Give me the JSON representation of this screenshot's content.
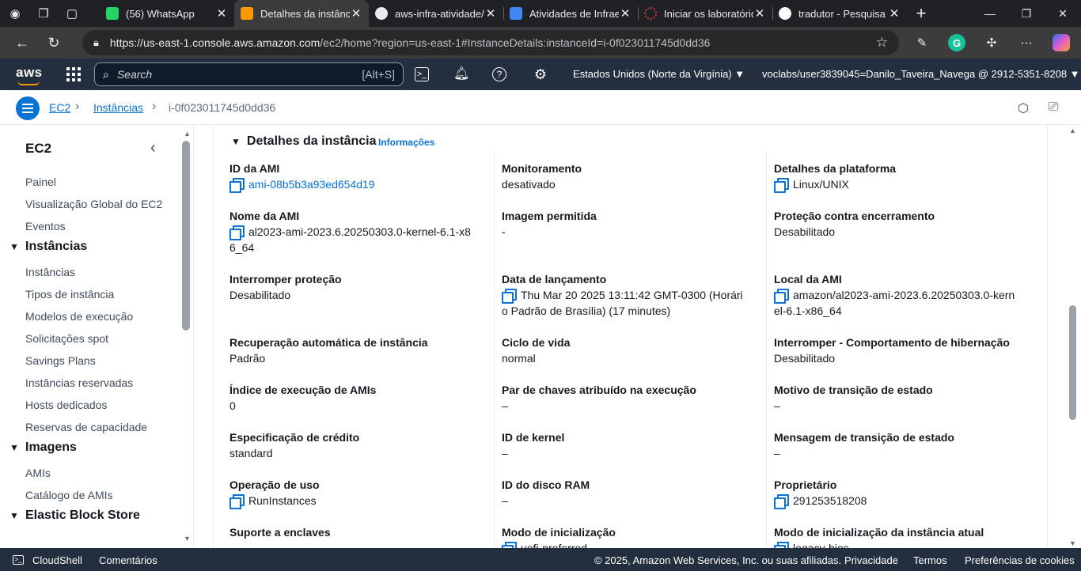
{
  "browser": {
    "tabs": [
      {
        "title": "(56) WhatsApp",
        "color": "#25d366",
        "icon": "whatsapp-icon"
      },
      {
        "title": "Detalhes da instância",
        "color": "#ff9900",
        "icon": "aws-icon",
        "active": true
      },
      {
        "title": "aws-infra-atividade/",
        "color": "#e8eaed",
        "icon": "github-icon"
      },
      {
        "title": "Atividades de Infrae",
        "color": "#4285f4",
        "icon": "profile-icon"
      },
      {
        "title": "Iniciar os laboratório",
        "color": "#c53a3a",
        "icon": "loading-icon"
      },
      {
        "title": "tradutor - Pesquisa G",
        "color": "#ffffff",
        "icon": "google-icon"
      }
    ],
    "url_host": "https://us-east-1.console.aws.amazon.com",
    "url_path": "/ec2/home?region=us-east-1#InstanceDetails:instanceId=i-0f023011745d0dd36"
  },
  "awsnav": {
    "logo": "aws",
    "search_placeholder": "Search",
    "search_shortcut": "[Alt+S]",
    "region": "Estados Unidos (Norte da Virgínia) ▼",
    "account": "voclabs/user3839045=Danilo_Taveira_Navega @ 2912-5351-8208 ▼"
  },
  "breadcrumb": {
    "ec2": "EC2",
    "instances": "Instâncias",
    "instance_id": "i-0f023011745d0dd36"
  },
  "sidebar": {
    "title": "EC2",
    "items_top": [
      "Painel",
      "Visualização Global do EC2",
      "Eventos"
    ],
    "sections": [
      {
        "label": "Instâncias",
        "items": [
          "Instâncias",
          "Tipos de instância",
          "Modelos de execução",
          "Solicitações spot",
          "Savings Plans",
          "Instâncias reservadas",
          "Hosts dedicados",
          "Reservas de capacidade"
        ]
      },
      {
        "label": "Imagens",
        "items": [
          "AMIs",
          "Catálogo de AMIs"
        ]
      },
      {
        "label": "Elastic Block Store",
        "items": []
      }
    ]
  },
  "panel": {
    "title": "Detalhes da instância",
    "info_link": "Informações",
    "col1": [
      {
        "label": "ID da AMI",
        "value": "ami-08b5b3a93ed654d19",
        "copy": true,
        "link": true
      },
      {
        "label": "Nome da AMI",
        "value_lines": [
          "al2023-ami-2023.6.20250303.0-kernel-6.1-x8",
          "6_64"
        ],
        "copy": true
      },
      {
        "label": "Interromper proteção",
        "value": "Desabilitado"
      },
      {
        "label": "Recuperação automática de instância",
        "value": "Padrão"
      },
      {
        "label": "Índice de execução de AMIs",
        "value": "0"
      },
      {
        "label": "Especificação de crédito",
        "value": "standard"
      },
      {
        "label": "Operação de uso",
        "value": "RunInstances",
        "copy": true
      },
      {
        "label": "Suporte a enclaves",
        "value": "–"
      }
    ],
    "col2": [
      {
        "label": "Monitoramento",
        "value": "desativado"
      },
      {
        "label": "Imagem permitida",
        "value": "-"
      },
      {
        "label": "Data de lançamento",
        "value_lines": [
          "Thu Mar 20 2025 13:11:42 GMT-0300 (Horári",
          "o Padrão de Brasília) (17 minutes)"
        ],
        "copy": true
      },
      {
        "label": "Ciclo de vida",
        "value": "normal"
      },
      {
        "label": "Par de chaves atribuído na execução",
        "value": "–"
      },
      {
        "label": "ID de kernel",
        "value": "–"
      },
      {
        "label": "ID do disco RAM",
        "value": "–"
      },
      {
        "label": "Modo de inicialização",
        "value": "uefi-preferred",
        "copy": true
      }
    ],
    "col3": [
      {
        "label": "Detalhes da plataforma",
        "value": "Linux/UNIX",
        "copy": true
      },
      {
        "label": "Proteção contra encerramento",
        "value": "Desabilitado"
      },
      {
        "label": "Local da AMI",
        "value_lines": [
          "amazon/al2023-ami-2023.6.20250303.0-kern",
          "el-6.1-x86_64"
        ],
        "copy": true
      },
      {
        "label": "Interromper - Comportamento de hibernação",
        "value": "Desabilitado"
      },
      {
        "label": "Motivo de transição de estado",
        "value": "–"
      },
      {
        "label": "Mensagem de transição de estado",
        "value": "–"
      },
      {
        "label": "Proprietário",
        "value": "291253518208",
        "copy": true
      },
      {
        "label": "Modo de inicialização da instância atual",
        "value": "legacy-bios",
        "copy": true
      }
    ]
  },
  "footer": {
    "cloudshell": "CloudShell",
    "comments": "Comentários",
    "copyright": "© 2025, Amazon Web Services, Inc. ou suas afiliadas.",
    "privacy": "Privacidade",
    "terms": "Termos",
    "cookies": "Preferências de cookies"
  }
}
